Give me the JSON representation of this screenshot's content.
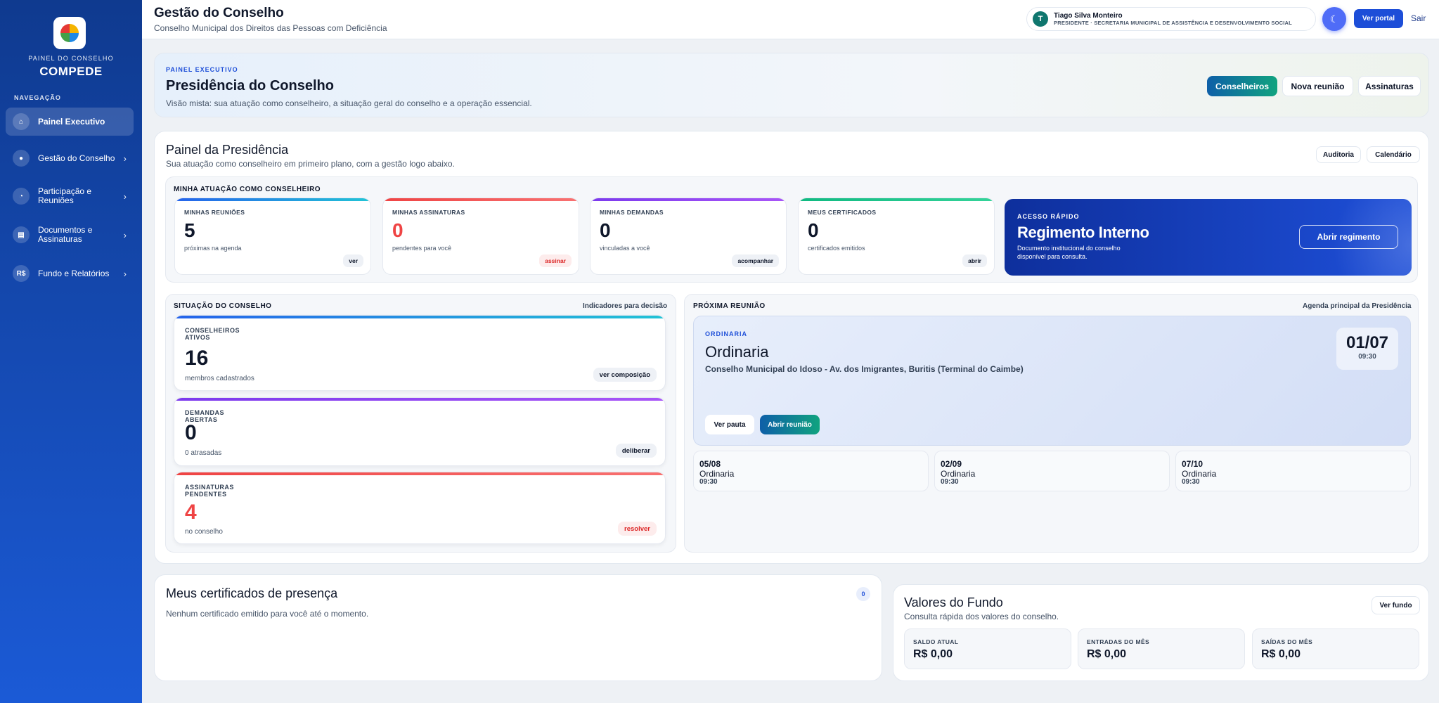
{
  "sidebar": {
    "brand_sub": "PAINEL DO CONSELHO",
    "brand_name": "COMPEDE",
    "nav_heading": "NAVEGAÇÃO",
    "items": [
      {
        "label": "Painel Executivo",
        "icon": "⌂"
      },
      {
        "label": "Gestão do Conselho",
        "icon": "●"
      },
      {
        "label": "Participação e Reuniões",
        "icon": "◔"
      },
      {
        "label": "Documentos e Assinaturas",
        "icon": "▤"
      },
      {
        "label": "Fundo e Relatórios",
        "icon": "R$"
      }
    ]
  },
  "topbar": {
    "title": "Gestão do Conselho",
    "subtitle": "Conselho Municipal dos Direitos das Pessoas com Deficiência",
    "user_initial": "T",
    "user_name": "Tiago Silva Monteiro",
    "user_role": "PRESIDENTE · SECRETARIA MUNICIPAL DE ASSISTÊNCIA E DESENVOLVIMENTO SOCIAL",
    "portal_label": "Ver portal",
    "logout_label": "Sair"
  },
  "hero": {
    "kicker": "PAINEL EXECUTIVO",
    "title": "Presidência do Conselho",
    "subtitle": "Visão mista: sua atuação como conselheiro, a situação geral do conselho e a operação essencial.",
    "buttons": [
      "Conselheiros",
      "Nova reunião",
      "Assinaturas"
    ]
  },
  "panel": {
    "title": "Painel da Presidência",
    "subtitle": "Sua atuação como conselheiro em primeiro plano, com a gestão logo abaixo.",
    "audit_label": "Auditoria",
    "calendar_label": "Calendário",
    "my_section_title": "MINHA ATUAÇÃO COMO CONSELHEIRO",
    "my_cards": [
      {
        "label": "MINHAS REUNIÕES",
        "value": "5",
        "sub": "próximas na agenda",
        "action": "ver"
      },
      {
        "label": "MINHAS ASSINATURAS",
        "value": "0",
        "sub": "pendentes para você",
        "action": "assinar"
      },
      {
        "label": "MINHAS DEMANDAS",
        "value": "0",
        "sub": "vinculadas a você",
        "action": "acompanhar"
      },
      {
        "label": "MEUS CERTIFICADOS",
        "value": "0",
        "sub": "certificados emitidos",
        "action": "abrir"
      }
    ],
    "quick": {
      "kicker": "ACESSO RÁPIDO",
      "title": "Regimento Interno",
      "sub": "Documento institucional do conselho disponível para consulta.",
      "button": "Abrir regimento"
    },
    "situation_title": "SITUAÇÃO DO CONSELHO",
    "situation_right": "Indicadores para decisão",
    "stats": [
      {
        "label": "CONSELHEIROS ATIVOS",
        "value": "16",
        "sub": "membros cadastrados",
        "action": "ver composição"
      },
      {
        "label": "DEMANDAS ABERTAS",
        "value": "0",
        "sub": "0 atrasadas",
        "action": "deliberar"
      },
      {
        "label": "ASSINATURAS PENDENTES",
        "value": "4",
        "sub": "no conselho",
        "action": "resolver"
      }
    ],
    "next_meeting_title": "PRÓXIMA REUNIÃO",
    "next_meeting_right": "Agenda principal da Presidência",
    "meeting": {
      "kicker": "ORDINARIA",
      "title": "Ordinaria",
      "location": "Conselho Municipal do Idoso - Av. dos Imigrantes, Buritis (Terminal do Caimbe)",
      "date": "01/07",
      "time": "09:30",
      "agenda_label": "Ver pauta",
      "open_label": "Abrir reunião"
    },
    "upcoming": [
      {
        "date": "05/08",
        "name": "Ordinaria",
        "time": "09:30"
      },
      {
        "date": "02/09",
        "name": "Ordinaria",
        "time": "09:30"
      },
      {
        "date": "07/10",
        "name": "Ordinaria",
        "time": "09:30"
      }
    ]
  },
  "certificates": {
    "title": "Meus certificados de presença",
    "count": "0",
    "empty": "Nenhum certificado emitido para você até o momento."
  },
  "fund": {
    "title": "Valores do Fundo",
    "subtitle": "Consulta rápida dos valores do conselho.",
    "button": "Ver fundo",
    "boxes": [
      {
        "label": "SALDO ATUAL",
        "value": "R$ 0,00"
      },
      {
        "label": "ENTRADAS DO MÊS",
        "value": "R$ 0,00"
      },
      {
        "label": "SAÍDAS DO MÊS",
        "value": "R$ 0,00"
      }
    ]
  },
  "colors": {
    "sidebar_top": "#0f3a8f",
    "sidebar_bottom": "#1b5ad6",
    "accent_blue": "#1d4ed8",
    "accent_green": "#10a37f",
    "alert_red": "#ef4444"
  }
}
